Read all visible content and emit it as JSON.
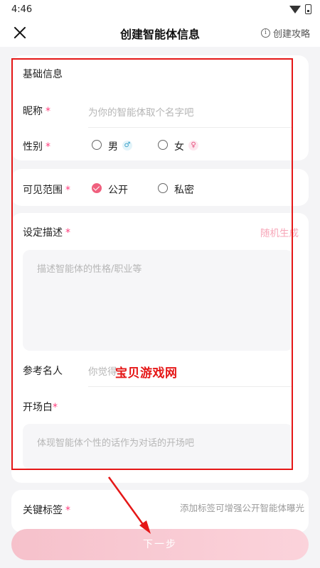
{
  "status_bar": {
    "time": "4:46"
  },
  "header": {
    "title": "创建智能体信息",
    "guide_label": "创建攻略",
    "info_glyph": "i"
  },
  "basic_info": {
    "section_title": "基础信息",
    "nickname": {
      "label": "昵称",
      "required_mark": "*",
      "placeholder": "为你的智能体取个名字吧"
    },
    "gender": {
      "label": "性别",
      "required_mark": "*",
      "options": [
        {
          "label": "男",
          "badge": "♂",
          "checked": false
        },
        {
          "label": "女",
          "badge": "♀",
          "checked": false
        }
      ]
    }
  },
  "visibility": {
    "label": "可见范围",
    "required_mark": "*",
    "options": [
      {
        "label": "公开",
        "checked": true
      },
      {
        "label": "私密",
        "checked": false
      }
    ]
  },
  "setting": {
    "label": "设定描述",
    "required_mark": "*",
    "random_label": "随机生成",
    "placeholder": "描述智能体的性格/职业等"
  },
  "reference": {
    "label": "参考名人",
    "placeholder": "你觉得"
  },
  "opening": {
    "label": "开场白",
    "required_mark": "*",
    "placeholder": "体现智能体个性的话作为对话的开场吧"
  },
  "tags": {
    "label": "关键标签",
    "required_mark": "*",
    "hint": "添加标签可增强公开智能体曝光"
  },
  "footer": {
    "next_label": "下一步"
  },
  "watermark": "宝贝游戏网",
  "colors": {
    "accent": "#f0607e",
    "required": "#ff3b7b",
    "annotation": "#e51717"
  }
}
